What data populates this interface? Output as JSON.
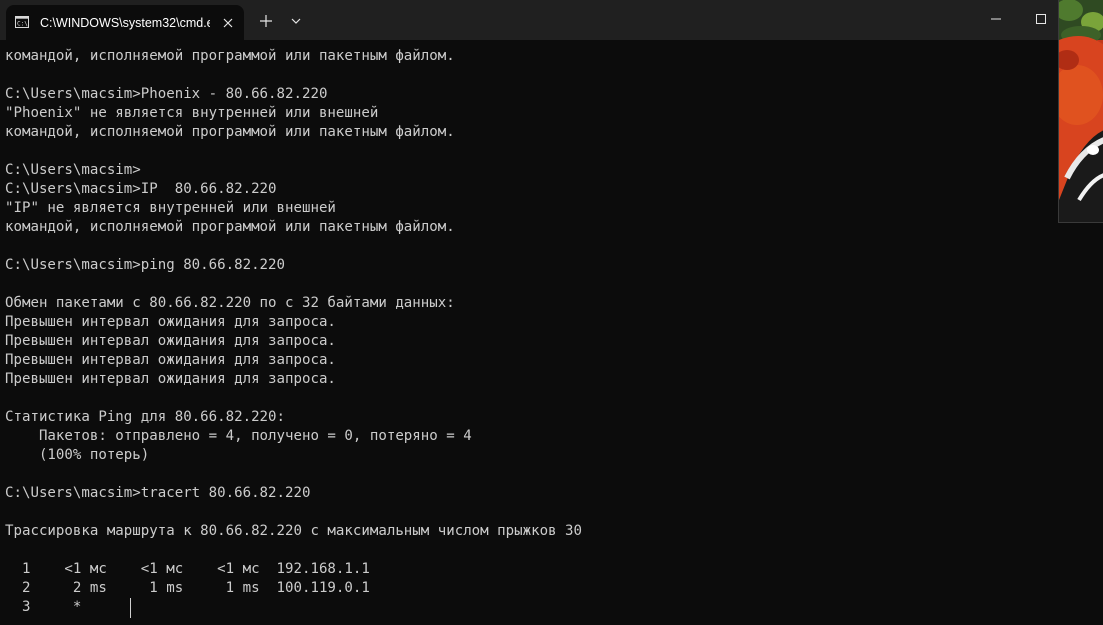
{
  "window": {
    "tab_title": "C:\\WINDOWS\\system32\\cmd.e",
    "icons": {
      "tab": "cmd-icon",
      "close": "close-icon",
      "new_tab": "plus-icon",
      "dropdown": "chevron-down-icon",
      "minimize": "minimize-icon",
      "maximize": "maximize-icon"
    }
  },
  "colors": {
    "terminal_bg": "#0c0c0c",
    "terminal_text": "#cccccc",
    "titlebar_bg": "#202020"
  },
  "terminal": {
    "lines": [
      "командой, исполняемой программой или пакетным файлом.",
      "",
      "C:\\Users\\macsim>Phoenix - 80.66.82.220",
      "\"Phoenix\" не является внутренней или внешней",
      "командой, исполняемой программой или пакетным файлом.",
      "",
      "C:\\Users\\macsim>",
      "C:\\Users\\macsim>IP  80.66.82.220",
      "\"IP\" не является внутренней или внешней",
      "командой, исполняемой программой или пакетным файлом.",
      "",
      "C:\\Users\\macsim>ping 80.66.82.220",
      "",
      "Обмен пакетами с 80.66.82.220 по с 32 байтами данных:",
      "Превышен интервал ожидания для запроса.",
      "Превышен интервал ожидания для запроса.",
      "Превышен интервал ожидания для запроса.",
      "Превышен интервал ожидания для запроса.",
      "",
      "Статистика Ping для 80.66.82.220:",
      "    Пакетов: отправлено = 4, получено = 0, потеряно = 4",
      "    (100% потерь)",
      "",
      "C:\\Users\\macsim>tracert 80.66.82.220",
      "",
      "Трассировка маршрута к 80.66.82.220 с максимальным числом прыжков 30",
      "",
      "  1    <1 мс    <1 мс    <1 мс  192.168.1.1",
      "  2     2 ms     1 ms     1 ms  100.119.0.1",
      "  3     *"
    ]
  }
}
